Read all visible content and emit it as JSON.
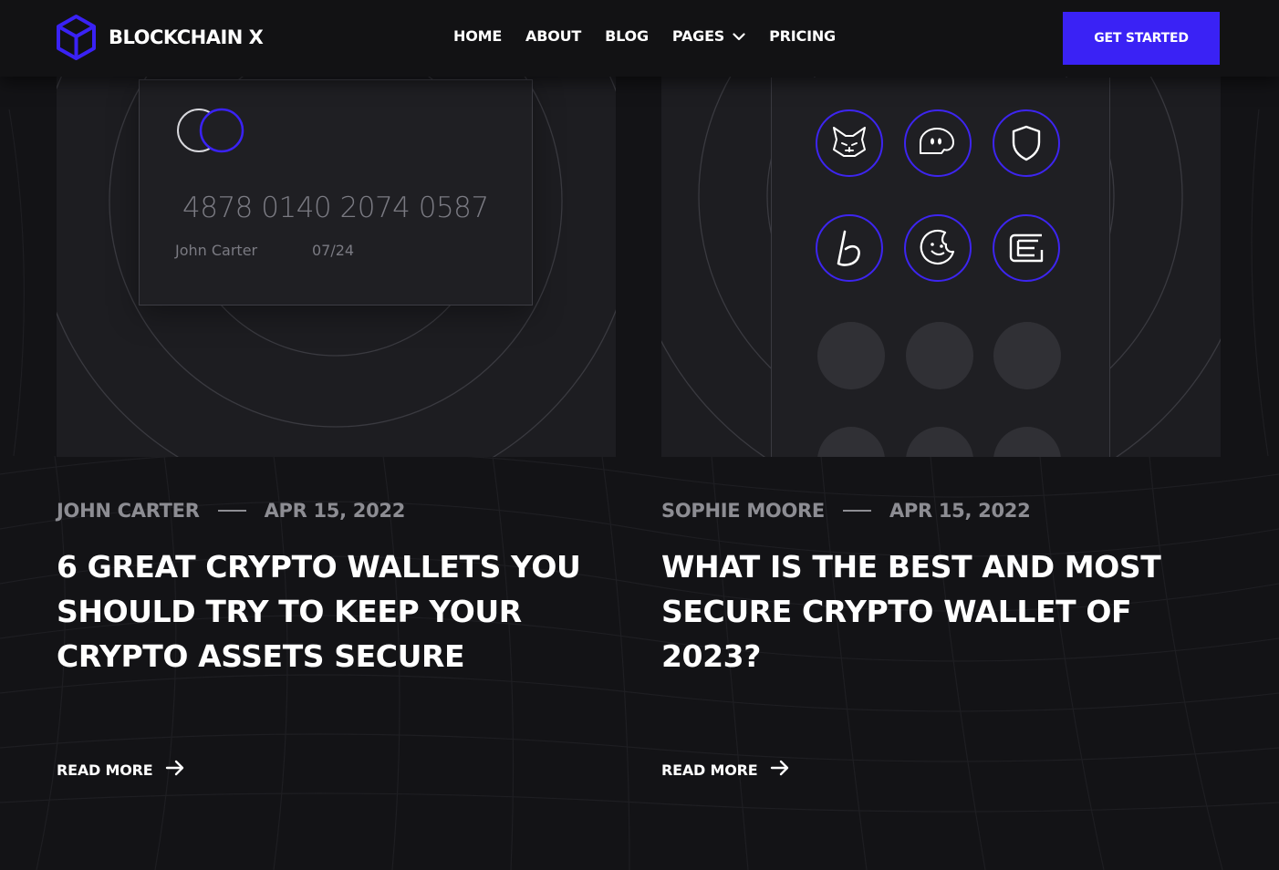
{
  "header": {
    "brand": "BLOCKCHAIN X",
    "nav": [
      {
        "label": "HOME"
      },
      {
        "label": "ABOUT"
      },
      {
        "label": "BLOG"
      },
      {
        "label": "PAGES"
      },
      {
        "label": "PRICING"
      }
    ],
    "cta_label": "GET STARTED"
  },
  "colors": {
    "accent": "#3a22f5",
    "background": "#131316",
    "muted_text": "#8d8d93"
  },
  "posts": [
    {
      "author": "JOHN CARTER",
      "date": "APR 15, 2022",
      "title": "6 GREAT CRYPTO WALLETS YOU SHOULD TRY TO KEEP YOUR CRYPTO ASSETS SECURE",
      "read_more": "READ MORE",
      "card": {
        "number": "4878  0140 2074 0587",
        "holder": "John Carter",
        "expiry": "07/24"
      }
    },
    {
      "author": "SOPHIE MOORE",
      "date": "APR 15, 2022",
      "title": "WHAT IS THE BEST AND MOST SECURE CRYPTO WALLET OF 2023?",
      "read_more": "READ MORE",
      "wallet_icons": [
        "metamask-fox-icon",
        "phantom-ghost-icon",
        "shield-icon",
        "bitcoin-b-icon",
        "cookie-face-icon",
        "exodus-e-icon"
      ]
    }
  ]
}
